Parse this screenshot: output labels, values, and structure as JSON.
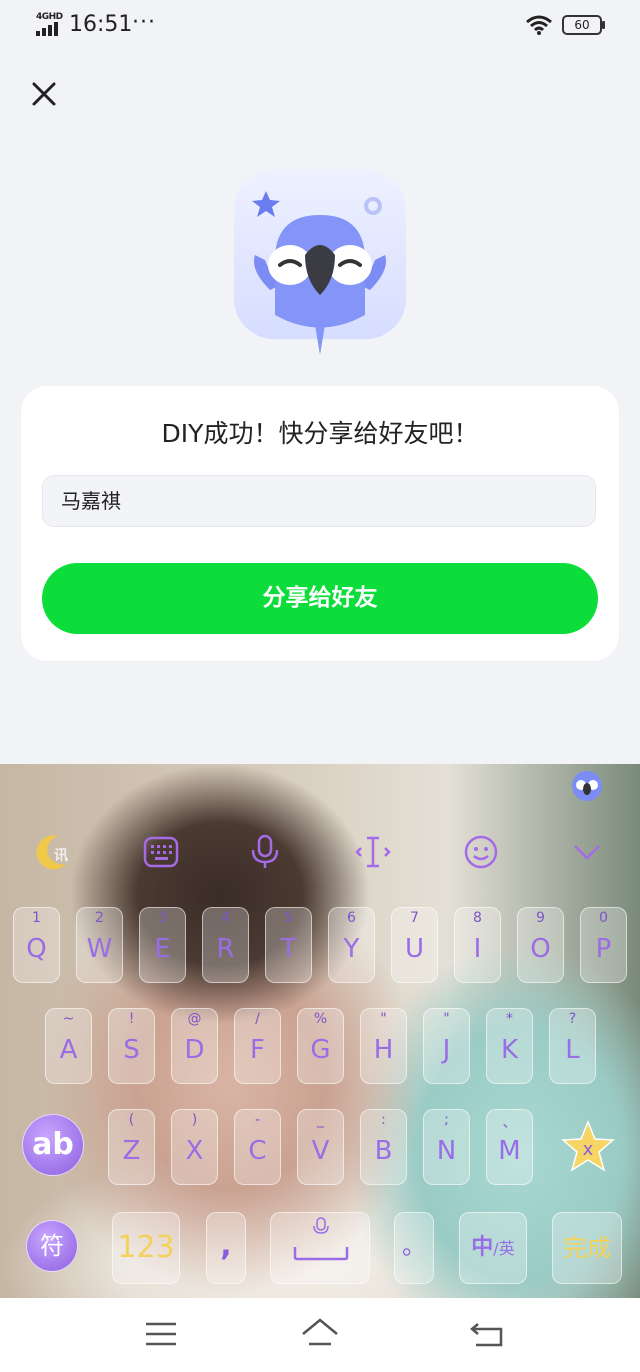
{
  "status_bar": {
    "network": "4GHD",
    "time": "16:51",
    "dots": "···",
    "battery": "60"
  },
  "card": {
    "title": "DIY成功！快分享给好友吧！",
    "name_value": "马嘉祺",
    "share_button": "分享给好友"
  },
  "keyboard": {
    "toolbar": [
      "xunfei-moon-logo-icon",
      "keyboard-icon",
      "microphone-icon",
      "cursor-icon",
      "emoji-icon",
      "chevron-down-icon"
    ],
    "row1": [
      {
        "sub": "1",
        "main": "Q"
      },
      {
        "sub": "2",
        "main": "W"
      },
      {
        "sub": "3",
        "main": "E"
      },
      {
        "sub": "4",
        "main": "R"
      },
      {
        "sub": "5",
        "main": "T"
      },
      {
        "sub": "6",
        "main": "Y"
      },
      {
        "sub": "7",
        "main": "U"
      },
      {
        "sub": "8",
        "main": "I"
      },
      {
        "sub": "9",
        "main": "O"
      },
      {
        "sub": "0",
        "main": "P"
      }
    ],
    "row2": [
      {
        "sub": "~",
        "main": "A"
      },
      {
        "sub": "!",
        "main": "S"
      },
      {
        "sub": "@",
        "main": "D"
      },
      {
        "sub": "/",
        "main": "F"
      },
      {
        "sub": "%",
        "main": "G"
      },
      {
        "sub": "\"",
        "main": "H"
      },
      {
        "sub": "\"",
        "main": "J"
      },
      {
        "sub": "*",
        "main": "K"
      },
      {
        "sub": "?",
        "main": "L"
      }
    ],
    "row3": [
      {
        "sub": "(",
        "main": "Z"
      },
      {
        "sub": ")",
        "main": "X"
      },
      {
        "sub": "-",
        "main": "C"
      },
      {
        "sub": "_",
        "main": "V"
      },
      {
        "sub": ":",
        "main": "B"
      },
      {
        "sub": ";",
        "main": "N"
      },
      {
        "sub": "、",
        "main": "M"
      }
    ],
    "shift_label": "ab",
    "delete_label": "x",
    "symbol_label": "符",
    "num_label": "123",
    "comma_label": ",",
    "period_label": "。",
    "lang_cn": "中",
    "lang_sep": "/",
    "lang_en": "英",
    "done_label": "完成",
    "accent_color": "#9a6ce6"
  },
  "nav_bar": [
    "menu-icon",
    "home-icon",
    "back-icon"
  ]
}
